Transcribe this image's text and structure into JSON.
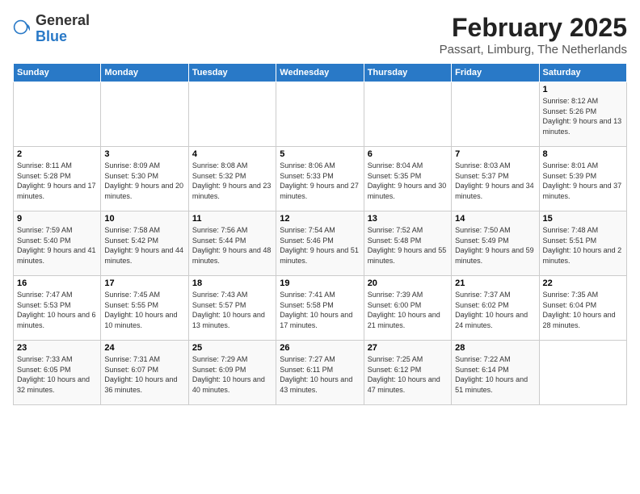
{
  "logo": {
    "general": "General",
    "blue": "Blue"
  },
  "title": "February 2025",
  "subtitle": "Passart, Limburg, The Netherlands",
  "days_of_week": [
    "Sunday",
    "Monday",
    "Tuesday",
    "Wednesday",
    "Thursday",
    "Friday",
    "Saturday"
  ],
  "weeks": [
    [
      {
        "day": "",
        "detail": ""
      },
      {
        "day": "",
        "detail": ""
      },
      {
        "day": "",
        "detail": ""
      },
      {
        "day": "",
        "detail": ""
      },
      {
        "day": "",
        "detail": ""
      },
      {
        "day": "",
        "detail": ""
      },
      {
        "day": "1",
        "detail": "Sunrise: 8:12 AM\nSunset: 5:26 PM\nDaylight: 9 hours and 13 minutes."
      }
    ],
    [
      {
        "day": "2",
        "detail": "Sunrise: 8:11 AM\nSunset: 5:28 PM\nDaylight: 9 hours and 17 minutes."
      },
      {
        "day": "3",
        "detail": "Sunrise: 8:09 AM\nSunset: 5:30 PM\nDaylight: 9 hours and 20 minutes."
      },
      {
        "day": "4",
        "detail": "Sunrise: 8:08 AM\nSunset: 5:32 PM\nDaylight: 9 hours and 23 minutes."
      },
      {
        "day": "5",
        "detail": "Sunrise: 8:06 AM\nSunset: 5:33 PM\nDaylight: 9 hours and 27 minutes."
      },
      {
        "day": "6",
        "detail": "Sunrise: 8:04 AM\nSunset: 5:35 PM\nDaylight: 9 hours and 30 minutes."
      },
      {
        "day": "7",
        "detail": "Sunrise: 8:03 AM\nSunset: 5:37 PM\nDaylight: 9 hours and 34 minutes."
      },
      {
        "day": "8",
        "detail": "Sunrise: 8:01 AM\nSunset: 5:39 PM\nDaylight: 9 hours and 37 minutes."
      }
    ],
    [
      {
        "day": "9",
        "detail": "Sunrise: 7:59 AM\nSunset: 5:40 PM\nDaylight: 9 hours and 41 minutes."
      },
      {
        "day": "10",
        "detail": "Sunrise: 7:58 AM\nSunset: 5:42 PM\nDaylight: 9 hours and 44 minutes."
      },
      {
        "day": "11",
        "detail": "Sunrise: 7:56 AM\nSunset: 5:44 PM\nDaylight: 9 hours and 48 minutes."
      },
      {
        "day": "12",
        "detail": "Sunrise: 7:54 AM\nSunset: 5:46 PM\nDaylight: 9 hours and 51 minutes."
      },
      {
        "day": "13",
        "detail": "Sunrise: 7:52 AM\nSunset: 5:48 PM\nDaylight: 9 hours and 55 minutes."
      },
      {
        "day": "14",
        "detail": "Sunrise: 7:50 AM\nSunset: 5:49 PM\nDaylight: 9 hours and 59 minutes."
      },
      {
        "day": "15",
        "detail": "Sunrise: 7:48 AM\nSunset: 5:51 PM\nDaylight: 10 hours and 2 minutes."
      }
    ],
    [
      {
        "day": "16",
        "detail": "Sunrise: 7:47 AM\nSunset: 5:53 PM\nDaylight: 10 hours and 6 minutes."
      },
      {
        "day": "17",
        "detail": "Sunrise: 7:45 AM\nSunset: 5:55 PM\nDaylight: 10 hours and 10 minutes."
      },
      {
        "day": "18",
        "detail": "Sunrise: 7:43 AM\nSunset: 5:57 PM\nDaylight: 10 hours and 13 minutes."
      },
      {
        "day": "19",
        "detail": "Sunrise: 7:41 AM\nSunset: 5:58 PM\nDaylight: 10 hours and 17 minutes."
      },
      {
        "day": "20",
        "detail": "Sunrise: 7:39 AM\nSunset: 6:00 PM\nDaylight: 10 hours and 21 minutes."
      },
      {
        "day": "21",
        "detail": "Sunrise: 7:37 AM\nSunset: 6:02 PM\nDaylight: 10 hours and 24 minutes."
      },
      {
        "day": "22",
        "detail": "Sunrise: 7:35 AM\nSunset: 6:04 PM\nDaylight: 10 hours and 28 minutes."
      }
    ],
    [
      {
        "day": "23",
        "detail": "Sunrise: 7:33 AM\nSunset: 6:05 PM\nDaylight: 10 hours and 32 minutes."
      },
      {
        "day": "24",
        "detail": "Sunrise: 7:31 AM\nSunset: 6:07 PM\nDaylight: 10 hours and 36 minutes."
      },
      {
        "day": "25",
        "detail": "Sunrise: 7:29 AM\nSunset: 6:09 PM\nDaylight: 10 hours and 40 minutes."
      },
      {
        "day": "26",
        "detail": "Sunrise: 7:27 AM\nSunset: 6:11 PM\nDaylight: 10 hours and 43 minutes."
      },
      {
        "day": "27",
        "detail": "Sunrise: 7:25 AM\nSunset: 6:12 PM\nDaylight: 10 hours and 47 minutes."
      },
      {
        "day": "28",
        "detail": "Sunrise: 7:22 AM\nSunset: 6:14 PM\nDaylight: 10 hours and 51 minutes."
      },
      {
        "day": "",
        "detail": ""
      }
    ]
  ]
}
